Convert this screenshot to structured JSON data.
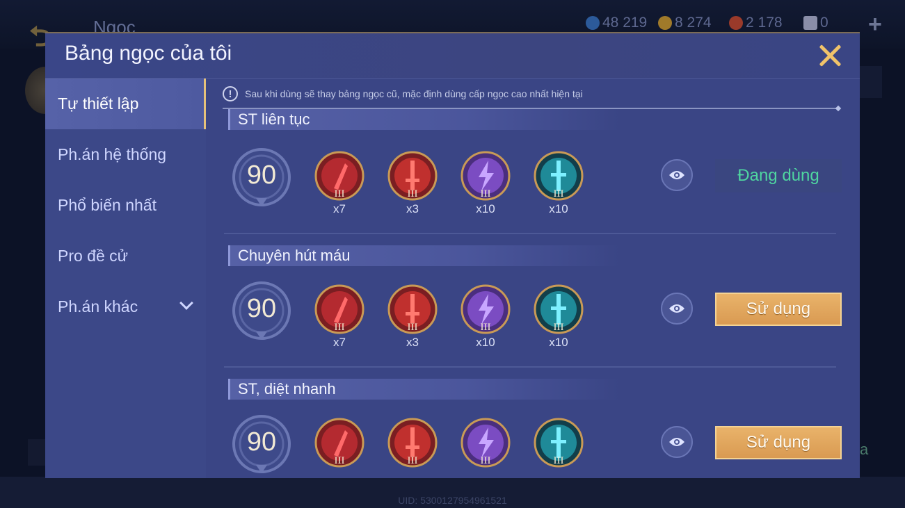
{
  "background": {
    "title": "Ngọc",
    "currencies": [
      {
        "icon": "blue-gem-icon",
        "value": "48 219",
        "color": "#3a72c8"
      },
      {
        "icon": "gold-coin-icon",
        "value": "8 274",
        "color": "#c89a3a"
      },
      {
        "icon": "red-gem-icon",
        "value": "2 178",
        "color": "#c8503a"
      },
      {
        "icon": "voucher-icon",
        "value": "0",
        "color": "#d8d8e8"
      }
    ],
    "plus": "+",
    "right_text": "a",
    "uid": "UID: 5300127954961521"
  },
  "modal": {
    "title": "Bảng ngọc của tôi",
    "notice": "Sau khi dùng sẽ thay bảng ngọc cũ, mặc định dùng cấp ngọc cao nhất hiện tại",
    "notice_icon": "!"
  },
  "sidebar": {
    "items": [
      {
        "label": "Tự thiết lập",
        "active": true
      },
      {
        "label": "Ph.án hệ thống",
        "active": false
      },
      {
        "label": "Phổ biến nhất",
        "active": false
      },
      {
        "label": "Pro đề cử",
        "active": false
      },
      {
        "label": "Ph.án khác",
        "active": false,
        "has_dropdown": true
      }
    ]
  },
  "sets": [
    {
      "title": "ST liên tục",
      "level": "90",
      "gems": [
        {
          "type": "red-blade",
          "tier": "III",
          "count": "x7"
        },
        {
          "type": "red-sword",
          "tier": "III",
          "count": "x3"
        },
        {
          "type": "purple-lightning",
          "tier": "III",
          "count": "x10"
        },
        {
          "type": "teal-sword",
          "tier": "III",
          "count": "x10"
        }
      ],
      "button": "Đang dùng",
      "button_state": "current"
    },
    {
      "title": "Chuyên hút máu",
      "level": "90",
      "gems": [
        {
          "type": "red-blade",
          "tier": "III",
          "count": "x7"
        },
        {
          "type": "red-sword",
          "tier": "III",
          "count": "x3"
        },
        {
          "type": "purple-lightning",
          "tier": "III",
          "count": "x10"
        },
        {
          "type": "teal-sword",
          "tier": "III",
          "count": "x10"
        }
      ],
      "button": "Sử dụng",
      "button_state": "use"
    },
    {
      "title": "ST, diệt nhanh",
      "level": "90",
      "gems": [
        {
          "type": "red-blade",
          "tier": "III",
          "count": ""
        },
        {
          "type": "red-sword",
          "tier": "III",
          "count": ""
        },
        {
          "type": "purple-lightning",
          "tier": "III",
          "count": ""
        },
        {
          "type": "teal-sword",
          "tier": "III",
          "count": ""
        }
      ],
      "button": "Sử dụng",
      "button_state": "use"
    }
  ],
  "colors": {
    "accent_gold": "#e6c27a",
    "current_green": "#4fd6a0",
    "red_gem": "#b8282e",
    "purple_gem": "#7b4cc2",
    "teal_gem": "#1f8a98"
  }
}
